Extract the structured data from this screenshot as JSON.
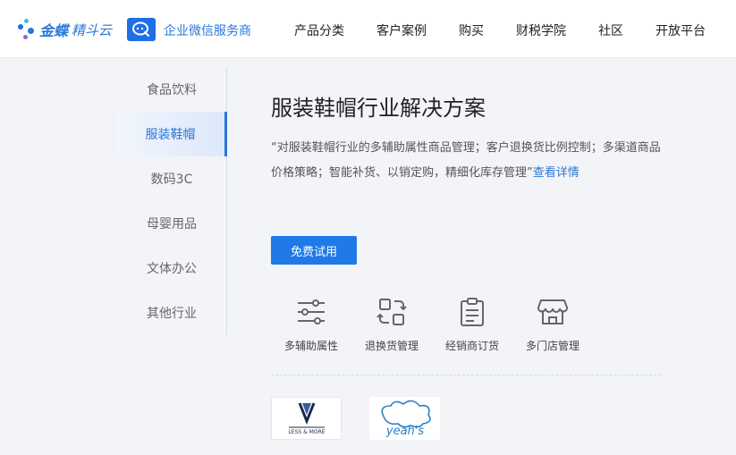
{
  "header": {
    "logo_brand": "金蝶",
    "logo_product": "精斗云",
    "partner_label": "企业微信服务商",
    "nav": [
      "产品分类",
      "客户案例",
      "购买",
      "财税学院",
      "社区",
      "开放平台"
    ]
  },
  "sidebar": {
    "items": [
      {
        "label": "食品饮料"
      },
      {
        "label": "服装鞋帽"
      },
      {
        "label": "数码3C"
      },
      {
        "label": "母婴用品"
      },
      {
        "label": "文体办公"
      },
      {
        "label": "其他行业"
      }
    ],
    "active_index": 1
  },
  "main": {
    "title": "服装鞋帽行业解决方案",
    "description": "“对服装鞋帽行业的多辅助属性商品管理；客户退换货比例控制；多渠道商品价格策略；智能补货、以销定购，精细化库存管理”",
    "detail_link": "查看详情",
    "trial_button": "免费试用",
    "features": [
      {
        "label": "多辅助属性",
        "icon": "sliders-icon"
      },
      {
        "label": "退换货管理",
        "icon": "exchange-icon"
      },
      {
        "label": "经销商订货",
        "icon": "clipboard-icon"
      },
      {
        "label": "多门店管理",
        "icon": "store-icon"
      }
    ],
    "brands": [
      {
        "name": "LESS & MORE",
        "icon": "less-more-logo"
      },
      {
        "name": "yeah's",
        "icon": "yeahs-logo"
      }
    ]
  },
  "colors": {
    "accent": "#2a77d9",
    "button": "#1f7ae8",
    "background": "#f2f4f8"
  }
}
